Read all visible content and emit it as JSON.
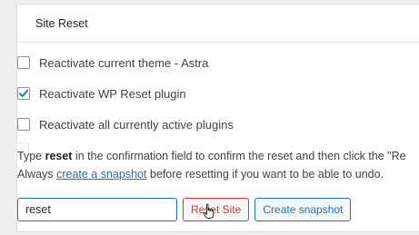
{
  "card": {
    "title": "Site Reset"
  },
  "options": [
    {
      "label": "Reactivate current theme - Astra",
      "checked": false
    },
    {
      "label": "Reactivate WP Reset plugin",
      "checked": true
    },
    {
      "label": "Reactivate all currently active plugins",
      "checked": false
    }
  ],
  "description": {
    "line1_before": "Type ",
    "line1_bold": "reset",
    "line1_after": " in the confirmation field to confirm the reset and then click the \"Re",
    "line2_before": "Always ",
    "line2_link": "create a snapshot",
    "line2_after": " before resetting if you want to be able to undo."
  },
  "form": {
    "confirm_value": "reset",
    "reset_button": "Reset Site",
    "snapshot_button": "Create snapshot"
  },
  "colors": {
    "link": "#2271b1",
    "danger": "#d63638"
  },
  "icons": {
    "check": "check-icon",
    "cursor": "hand-pointer-icon"
  }
}
